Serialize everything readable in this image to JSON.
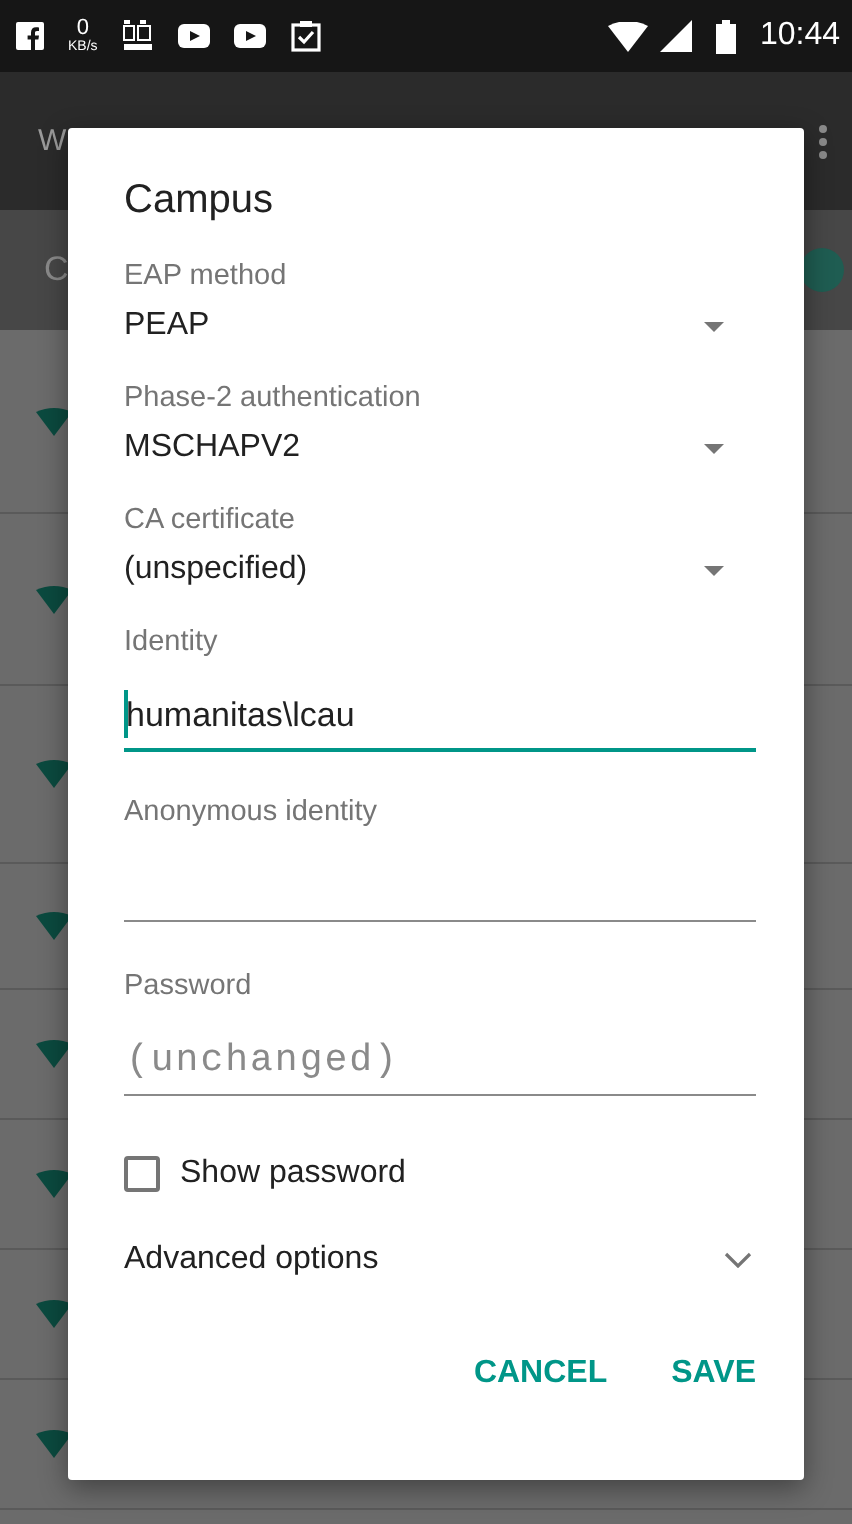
{
  "status_bar": {
    "speed_value": "0",
    "speed_unit": "KB/s",
    "time": "10:44"
  },
  "background": {
    "title": "W",
    "switch_label": "C",
    "switch_on": true
  },
  "dialog": {
    "title": "Campus",
    "fields": [
      {
        "kind": "dropdown",
        "label": "EAP method",
        "value": "PEAP"
      },
      {
        "kind": "dropdown",
        "label": "Phase-2 authentication",
        "value": "MSCHAPV2"
      },
      {
        "kind": "dropdown",
        "label": "CA certificate",
        "value": "(unspecified)"
      },
      {
        "kind": "text",
        "label": "Identity",
        "value": "humanitas\\lcau",
        "focused": true
      },
      {
        "kind": "text",
        "label": "Anonymous identity",
        "focused": false
      },
      {
        "kind": "password",
        "label": "Password",
        "placeholder": "(unchanged)",
        "focused": false
      }
    ],
    "show_password": {
      "label": "Show password",
      "checked": false
    },
    "advanced": {
      "label": "Advanced options",
      "expanded": false
    },
    "buttons": [
      "CANCEL",
      "SAVE"
    ]
  }
}
